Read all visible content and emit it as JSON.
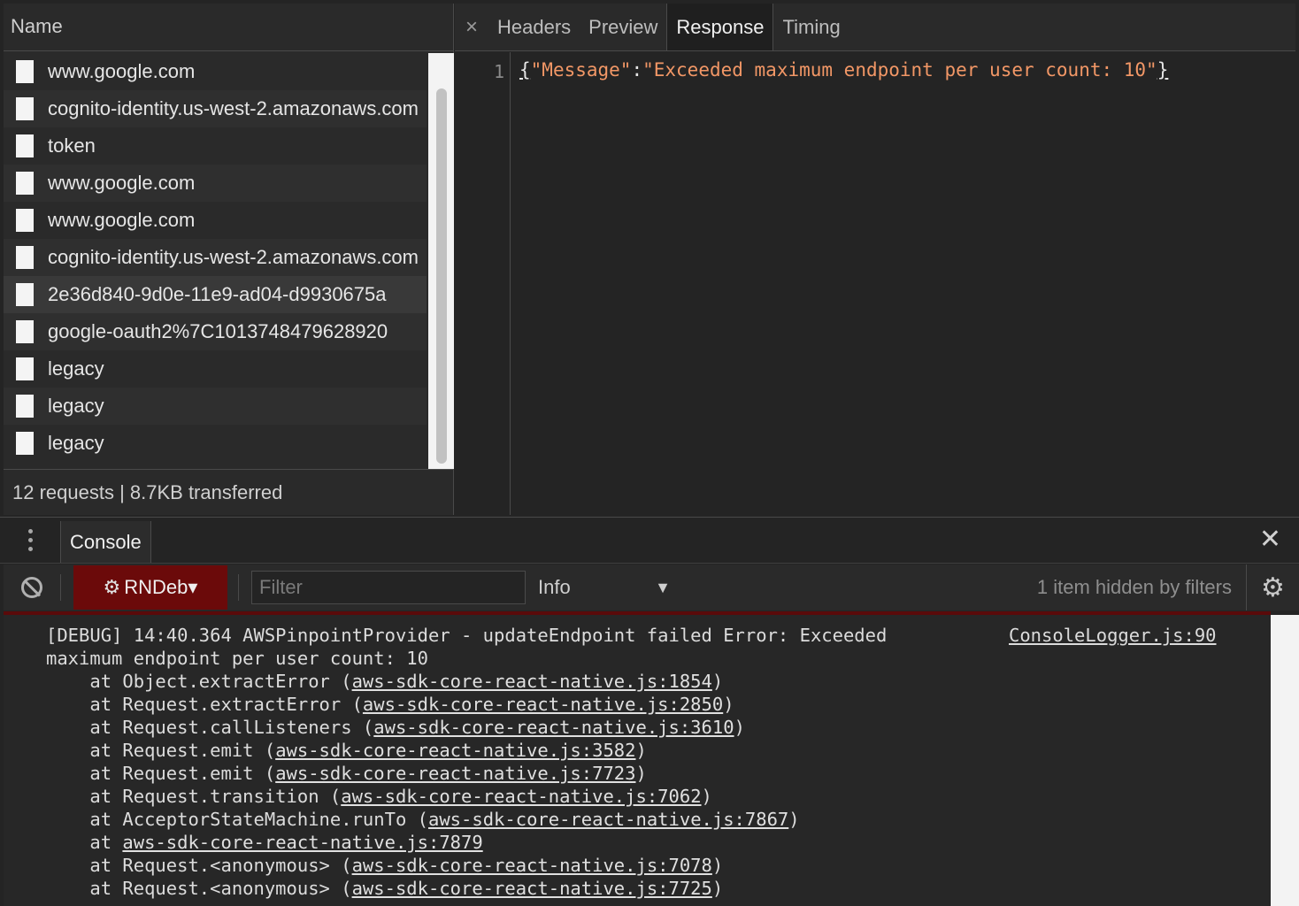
{
  "network": {
    "name_header": "Name",
    "requests": [
      "www.google.com",
      "cognito-identity.us-west-2.amazonaws.com",
      "token",
      "www.google.com",
      "www.google.com",
      "cognito-identity.us-west-2.amazonaws.com",
      "2e36d840-9d0e-11e9-ad04-d9930675a",
      "google-oauth2%7C1013748479628920",
      "legacy",
      "legacy",
      "legacy"
    ],
    "selected_index": 6,
    "status": "12 requests | 8.7KB transferred"
  },
  "details": {
    "close_glyph": "×",
    "tabs": [
      "Headers",
      "Preview",
      "Response",
      "Timing"
    ],
    "active_tab": "Response",
    "line_number": "1",
    "response": {
      "open": "{",
      "key": "\"Message\"",
      "colon": ":",
      "value": "\"Exceeded maximum endpoint per user count: 10\"",
      "close": "}"
    }
  },
  "drawer": {
    "tab": "Console",
    "close_glyph": "✕",
    "context_label": "RNDeb▾",
    "filter_placeholder": "Filter",
    "level": "Info",
    "hidden_text": "1 item hidden by filters",
    "accent_color": "#6b0a0a"
  },
  "console": {
    "message": "[DEBUG] 14:40.364 AWSPinpointProvider - updateEndpoint failed Error: Exceeded maximum endpoint per user count: 10",
    "source": "ConsoleLogger.js:90",
    "stack": [
      {
        "prefix": "    at Object.extractError (",
        "link": "aws-sdk-core-react-native.js:1854",
        "suffix": ")"
      },
      {
        "prefix": "    at Request.extractError (",
        "link": "aws-sdk-core-react-native.js:2850",
        "suffix": ")"
      },
      {
        "prefix": "    at Request.callListeners (",
        "link": "aws-sdk-core-react-native.js:3610",
        "suffix": ")"
      },
      {
        "prefix": "    at Request.emit (",
        "link": "aws-sdk-core-react-native.js:3582",
        "suffix": ")"
      },
      {
        "prefix": "    at Request.emit (",
        "link": "aws-sdk-core-react-native.js:7723",
        "suffix": ")"
      },
      {
        "prefix": "    at Request.transition (",
        "link": "aws-sdk-core-react-native.js:7062",
        "suffix": ")"
      },
      {
        "prefix": "    at AcceptorStateMachine.runTo (",
        "link": "aws-sdk-core-react-native.js:7867",
        "suffix": ")"
      },
      {
        "prefix": "    at ",
        "link": "aws-sdk-core-react-native.js:7879",
        "suffix": ""
      },
      {
        "prefix": "    at Request.<anonymous> (",
        "link": "aws-sdk-core-react-native.js:7078",
        "suffix": ")"
      },
      {
        "prefix": "    at Request.<anonymous> (",
        "link": "aws-sdk-core-react-native.js:7725",
        "suffix": ")"
      }
    ]
  }
}
